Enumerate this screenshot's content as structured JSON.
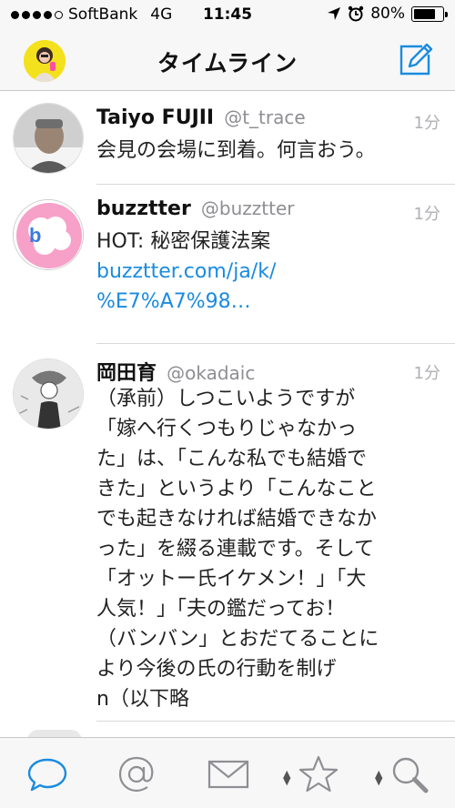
{
  "status_bar": {
    "carrier": "SoftBank",
    "network": "4G",
    "time": "11:45",
    "battery": "80%",
    "battery_level": 0.8,
    "signal_bars_filled": 4,
    "signal_bars_total": 5
  },
  "nav": {
    "title": "タイムライン",
    "left_icon": "user-avatar",
    "right_icon": "compose-icon",
    "accent": "#1a8be0"
  },
  "tweets": [
    {
      "name": "Taiyo FUJII",
      "handle": "@t_trace",
      "time": "1分",
      "text": "会見の会場に到着。何言おう。"
    },
    {
      "name": "buzztter",
      "handle": "@buzztter",
      "time": "1分",
      "text": "HOT: 秘密保護法案",
      "link_line1": "buzztter.com/ja/k/",
      "link_line2": "%E7%A7%98…"
    },
    {
      "name": "岡田育",
      "handle": "@okadaic",
      "time": "1分",
      "lines": [
        "（承前）しつこいようですが",
        "「嫁へ行くつもりじゃなかっ",
        "た」は、「こんな私でも結婚で",
        "きた」というより「こんなこと",
        "でも起きなければ結婚できなか",
        "った」を綴る連載です。そして",
        "「オットー氏イケメン！」「大",
        "人気！」「夫の鑑だってお！",
        "（バンバン」とおだてることに",
        "より今後の氏の行動を制げ",
        "n（以下略"
      ]
    }
  ],
  "tab_bar": {
    "tabs": [
      "speech-bubble-icon",
      "at-icon",
      "mail-icon",
      "star-icon",
      "search-icon"
    ],
    "active_tab": "speech-bubble-icon"
  }
}
